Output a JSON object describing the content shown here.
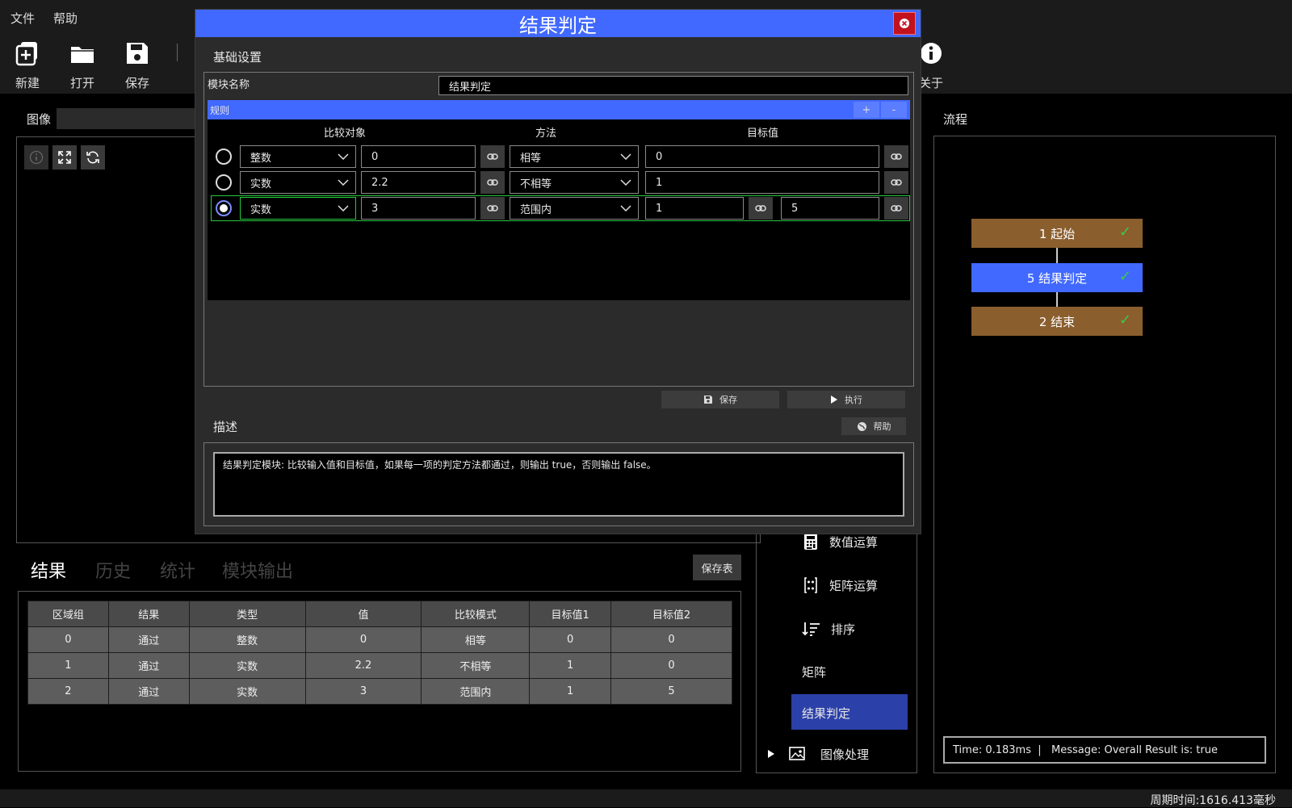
{
  "menu": {
    "file": "文件",
    "help": "帮助"
  },
  "toolbar": {
    "new": "新建",
    "open": "打开",
    "save": "保存",
    "about": "关于"
  },
  "image_panel": {
    "title": "图像"
  },
  "results": {
    "tabs": [
      "结果",
      "历史",
      "统计",
      "模块输出"
    ],
    "save_table": "保存表",
    "columns": [
      "区域组",
      "结果",
      "类型",
      "值",
      "比较模式",
      "目标值1",
      "目标值2"
    ],
    "rows": [
      [
        "0",
        "通过",
        "整数",
        "0",
        "相等",
        "0",
        "0"
      ],
      [
        "1",
        "通过",
        "实数",
        "2.2",
        "不相等",
        "1",
        "0"
      ],
      [
        "2",
        "通过",
        "实数",
        "3",
        "范围内",
        "1",
        "5"
      ]
    ]
  },
  "modules": {
    "items": [
      "数值运算",
      "矩阵运算",
      "排序",
      "矩阵",
      "结果判定",
      "图像处理"
    ],
    "selected": "结果判定"
  },
  "flow": {
    "title": "流程",
    "nodes": [
      {
        "label": "1 起始",
        "color": "#8b5e2e"
      },
      {
        "label": "5 结果判定",
        "color": "#4169ff"
      },
      {
        "label": "2 结束",
        "color": "#8b5e2e"
      }
    ],
    "status": "Time: 0.183ms  |   Message: Overall Result is: true"
  },
  "statusbar": {
    "cycle": "周期时间:1616.413毫秒"
  },
  "dialog": {
    "title": "结果判定",
    "basic_settings": "基础设置",
    "module_name_label": "模块名称",
    "module_name_value": "结果判定",
    "rules_label": "规则",
    "add": "+",
    "remove": "-",
    "col_compare": "比较对象",
    "col_method": "方法",
    "col_target": "目标值",
    "rules": [
      {
        "type": "整数",
        "value": "0",
        "method": "相等",
        "target1": "0",
        "target2": "",
        "selected": false
      },
      {
        "type": "实数",
        "value": "2.2",
        "method": "不相等",
        "target1": "1",
        "target2": "",
        "selected": false
      },
      {
        "type": "实数",
        "value": "3",
        "method": "范围内",
        "target1": "1",
        "target2": "5",
        "selected": true
      }
    ],
    "save_btn": "保存",
    "run_btn": "执行",
    "desc_label": "描述",
    "help_btn": "帮助",
    "description": "结果判定模块: 比较输入值和目标值，如果每一项的判定方法都通过，则输出 true，否则输出 false。"
  },
  "colors": {
    "accent": "#4169ff",
    "selected_module": "#2b40a8",
    "flow_node": "#8b5e2e",
    "check": "#3ec84a",
    "close": "#c1121f"
  }
}
